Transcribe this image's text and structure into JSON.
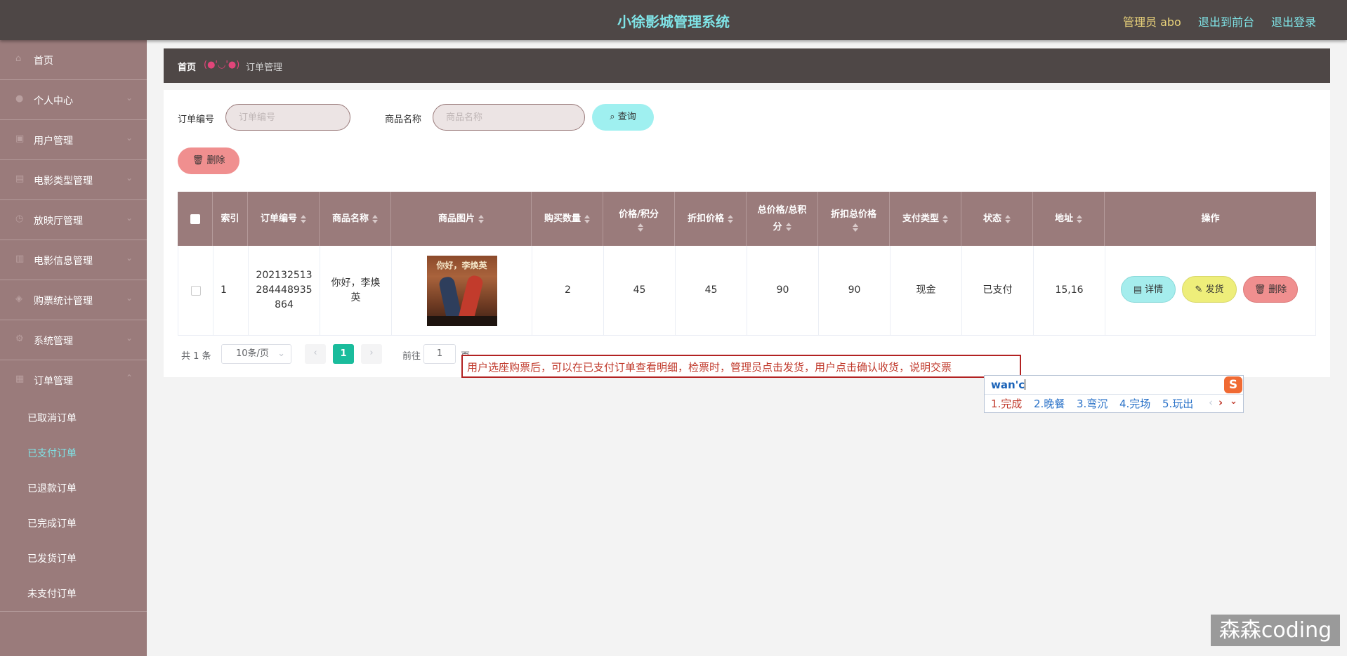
{
  "header": {
    "title": "小徐影城管理系统",
    "admin": "管理员 abo",
    "to_front": "退出到前台",
    "logout": "退出登录"
  },
  "sidebar": {
    "items": [
      {
        "label": "首页",
        "icon": "home-icon"
      },
      {
        "label": "个人中心",
        "icon": "user-icon"
      },
      {
        "label": "用户管理",
        "icon": "users-icon"
      },
      {
        "label": "电影类型管理",
        "icon": "category-icon"
      },
      {
        "label": "放映厅管理",
        "icon": "hall-icon"
      },
      {
        "label": "电影信息管理",
        "icon": "movie-icon"
      },
      {
        "label": "购票统计管理",
        "icon": "chart-icon"
      },
      {
        "label": "系统管理",
        "icon": "settings-icon"
      },
      {
        "label": "订单管理",
        "icon": "order-icon"
      }
    ],
    "sub_items": [
      "已取消订单",
      "已支付订单",
      "已退款订单",
      "已完成订单",
      "已发货订单",
      "未支付订单"
    ],
    "active_sub": "已支付订单"
  },
  "breadcrumb": {
    "home": "首页",
    "face": "(●'◡'●)",
    "current": "订单管理"
  },
  "search": {
    "order_no_label": "订单编号",
    "order_no_placeholder": "订单编号",
    "product_label": "商品名称",
    "product_placeholder": "商品名称",
    "query": "查询"
  },
  "toolbar": {
    "delete": "删除"
  },
  "table": {
    "headers": [
      "索引",
      "订单编号",
      "商品名称",
      "商品图片",
      "购买数量",
      "价格/积分",
      "折扣价格",
      "总价格/总积分",
      "折扣总价格",
      "支付类型",
      "状态",
      "地址",
      "操作"
    ],
    "rows": [
      {
        "index": "1",
        "order_no": "202132513284448935864",
        "order_no_lines": [
          "202132513",
          "284448935",
          "864"
        ],
        "product_lines": [
          "你好，李焕",
          "英"
        ],
        "poster_text": "你好，李焕英",
        "quantity": "2",
        "price": "45",
        "discount_price": "45",
        "total": "90",
        "discount_total": "90",
        "pay_type": "现金",
        "status": "已支付",
        "address": "15,16"
      }
    ],
    "actions": {
      "detail": "详情",
      "ship": "发货",
      "delete": "删除"
    }
  },
  "pagination": {
    "total": "共 1 条",
    "page_size": "10条/页",
    "current_page": "1",
    "goto_label": "前往",
    "goto_value": "1",
    "page_unit": "页"
  },
  "annotation": {
    "text": "用户选座购票后，可以在已支付订单查看明细，检票时，管理员点击发货，用户点击确认收货，说明交票"
  },
  "ime": {
    "composition": "wan'c",
    "candidates": [
      "1.完成",
      "2.晚餐",
      "3.弯沉",
      "4.完场",
      "5.玩出"
    ],
    "logo": "S"
  },
  "watermark": "森森coding",
  "colors": {
    "topbar": "#4e4746",
    "sidebar": "#9a7b7b",
    "accent": "#7fe3e6",
    "danger": "#f08f8f",
    "warning": "#eeee7a"
  }
}
